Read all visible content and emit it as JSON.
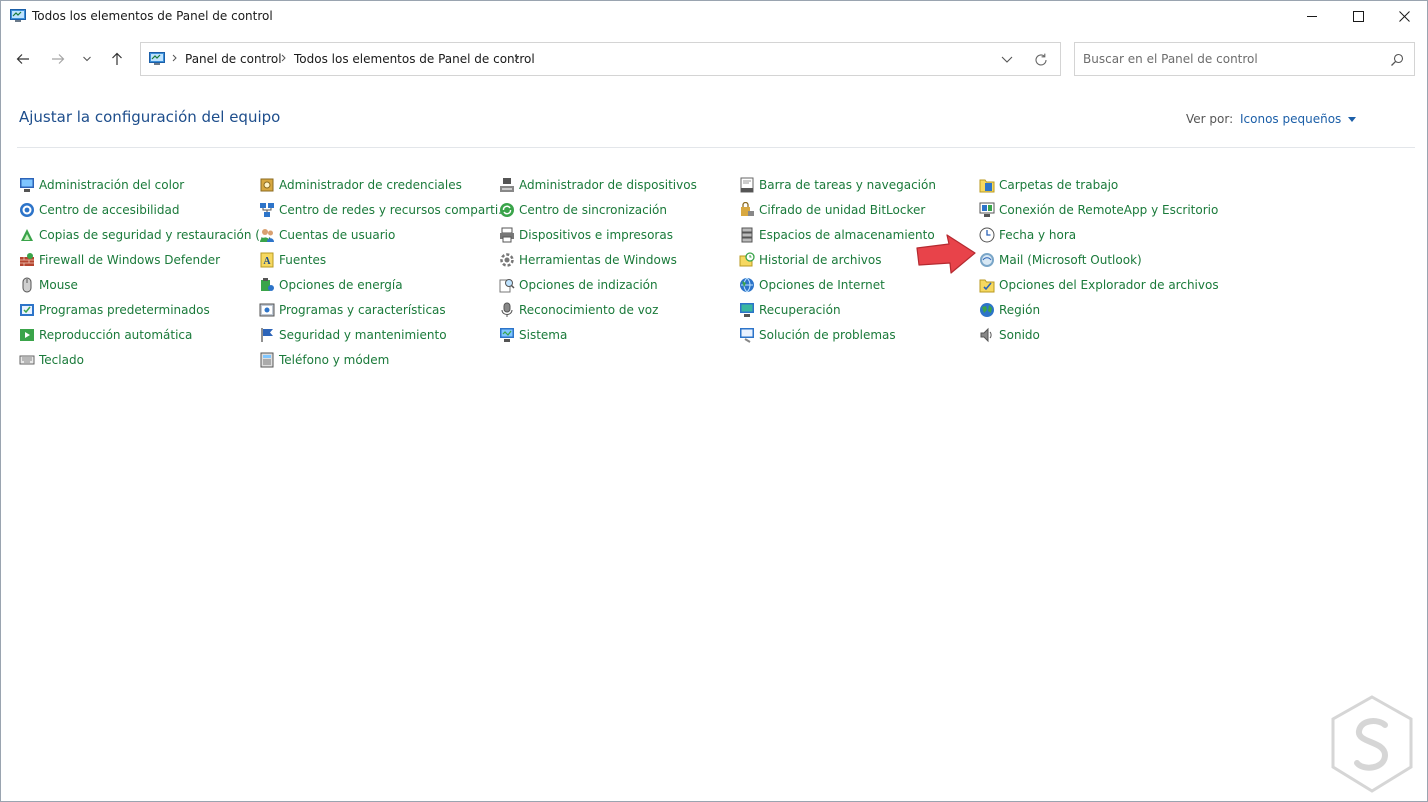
{
  "window": {
    "title": "Todos los elementos de Panel de control"
  },
  "navigation": {
    "breadcrumb": [
      "Panel de control",
      "Todos los elementos de Panel de control"
    ]
  },
  "search": {
    "placeholder": "Buscar en el Panel de control"
  },
  "header": {
    "title": "Ajustar la configuración del equipo",
    "view_by_label": "Ver por:",
    "view_by_value": "Iconos pequeños"
  },
  "items": [
    {
      "label": "Administración del color",
      "icon": "color-management-icon"
    },
    {
      "label": "Centro de accesibilidad",
      "icon": "accessibility-icon"
    },
    {
      "label": "Copias de seguridad y restauración (...",
      "icon": "backup-icon"
    },
    {
      "label": "Firewall de Windows Defender",
      "icon": "firewall-icon"
    },
    {
      "label": "Mouse",
      "icon": "mouse-icon"
    },
    {
      "label": "Programas predeterminados",
      "icon": "default-programs-icon"
    },
    {
      "label": "Reproducción automática",
      "icon": "autoplay-icon"
    },
    {
      "label": "Teclado",
      "icon": "keyboard-icon"
    },
    {
      "label": "Administrador de credenciales",
      "icon": "credentials-icon"
    },
    {
      "label": "Centro de redes y recursos comparti...",
      "icon": "network-icon"
    },
    {
      "label": "Cuentas de usuario",
      "icon": "user-accounts-icon"
    },
    {
      "label": "Fuentes",
      "icon": "fonts-icon"
    },
    {
      "label": "Opciones de energía",
      "icon": "power-icon"
    },
    {
      "label": "Programas y características",
      "icon": "programs-icon"
    },
    {
      "label": "Seguridad y mantenimiento",
      "icon": "security-flag-icon"
    },
    {
      "label": "Teléfono y módem",
      "icon": "phone-modem-icon"
    },
    {
      "label": "Administrador de dispositivos",
      "icon": "device-manager-icon"
    },
    {
      "label": "Centro de sincronización",
      "icon": "sync-icon"
    },
    {
      "label": "Dispositivos e impresoras",
      "icon": "printer-icon"
    },
    {
      "label": "Herramientas de Windows",
      "icon": "tools-icon"
    },
    {
      "label": "Opciones de indización",
      "icon": "indexing-icon"
    },
    {
      "label": "Reconocimiento de voz",
      "icon": "microphone-icon"
    },
    {
      "label": "Sistema",
      "icon": "system-icon"
    },
    {
      "label": "Barra de tareas y navegación",
      "icon": "taskbar-icon"
    },
    {
      "label": "Cifrado de unidad BitLocker",
      "icon": "bitlocker-icon"
    },
    {
      "label": "Espacios de almacenamiento",
      "icon": "storage-icon"
    },
    {
      "label": "Historial de archivos",
      "icon": "file-history-icon"
    },
    {
      "label": "Opciones de Internet",
      "icon": "internet-icon"
    },
    {
      "label": "Recuperación",
      "icon": "recovery-icon"
    },
    {
      "label": "Solución de problemas",
      "icon": "troubleshoot-icon"
    },
    {
      "label": "Carpetas de trabajo",
      "icon": "work-folders-icon"
    },
    {
      "label": "Conexión de RemoteApp y Escritorio",
      "icon": "remoteapp-icon"
    },
    {
      "label": "Fecha y hora",
      "icon": "clock-icon"
    },
    {
      "label": "Mail (Microsoft Outlook)",
      "icon": "mail-icon"
    },
    {
      "label": "Opciones del Explorador de archivos",
      "icon": "folder-options-icon"
    },
    {
      "label": "Región",
      "icon": "region-icon"
    },
    {
      "label": "Sonido",
      "icon": "speaker-icon"
    }
  ],
  "colors": {
    "link_green": "#1a7a3a",
    "title_blue": "#1e4e8c",
    "accent_blue": "#1c5fa8",
    "annotation_red": "#e8434a"
  }
}
